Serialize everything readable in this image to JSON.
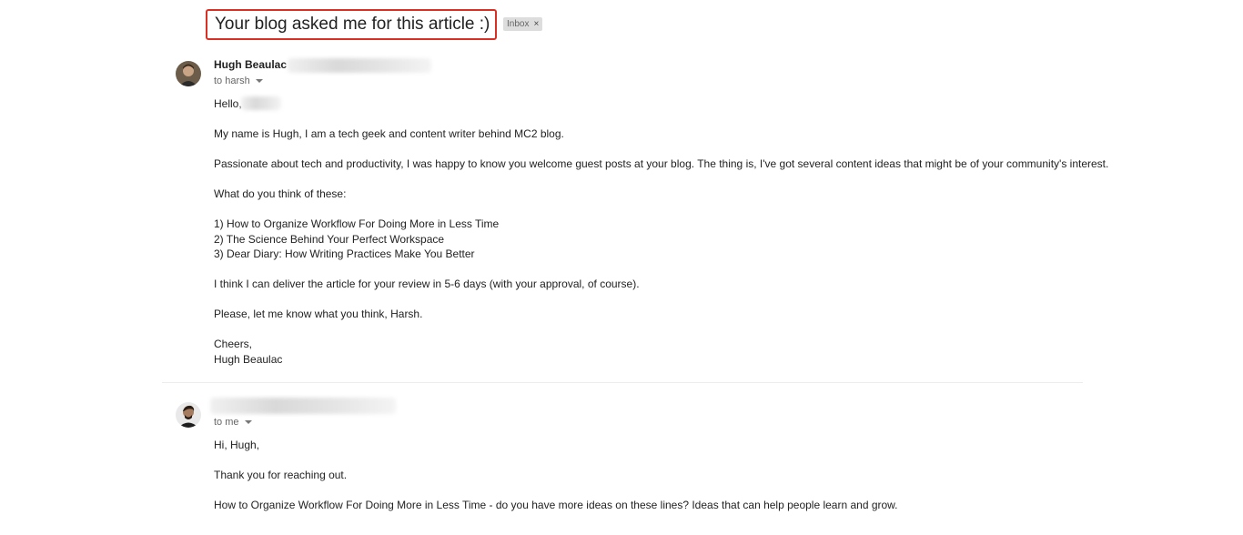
{
  "subject": "Your blog asked me for this article :)",
  "label_chip": "Inbox",
  "label_chip_close": "×",
  "messages": [
    {
      "sender": "Hugh Beaulac",
      "to_line": "to harsh",
      "body": {
        "greeting": "Hello,",
        "p1": "My name is Hugh, I am a tech geek and content writer behind MC2 blog.",
        "p2": "Passionate about tech and productivity, I was happy to know you welcome guest posts at your blog. The thing is, I've got several content ideas that might be of your community's interest.",
        "p3": "What do you think of these:",
        "list": [
          "1) How to Organize Workflow For Doing More in Less Time",
          "2) The Science Behind Your Perfect Workspace",
          "3) Dear Diary: How Writing Practices Make You Better"
        ],
        "p4": "I think I can deliver the article for your review in 5-6 days (with your approval, of course).",
        "p5": "Please, let me know what you think, Harsh.",
        "signoff": "Cheers,",
        "signature": "Hugh Beaulac"
      }
    },
    {
      "to_line": "to me",
      "body": {
        "greeting": "Hi, Hugh,",
        "p1": "Thank you for reaching out.",
        "p2": "How to Organize Workflow For Doing More in Less Time - do you have more ideas on these lines? Ideas that can help people learn and grow."
      }
    }
  ],
  "colors": {
    "highlight_border": "#d93025",
    "text": "#222222",
    "muted": "#666666",
    "chip_bg": "#dddddd"
  },
  "icons": [
    "chevron-down-icon",
    "close-icon"
  ]
}
